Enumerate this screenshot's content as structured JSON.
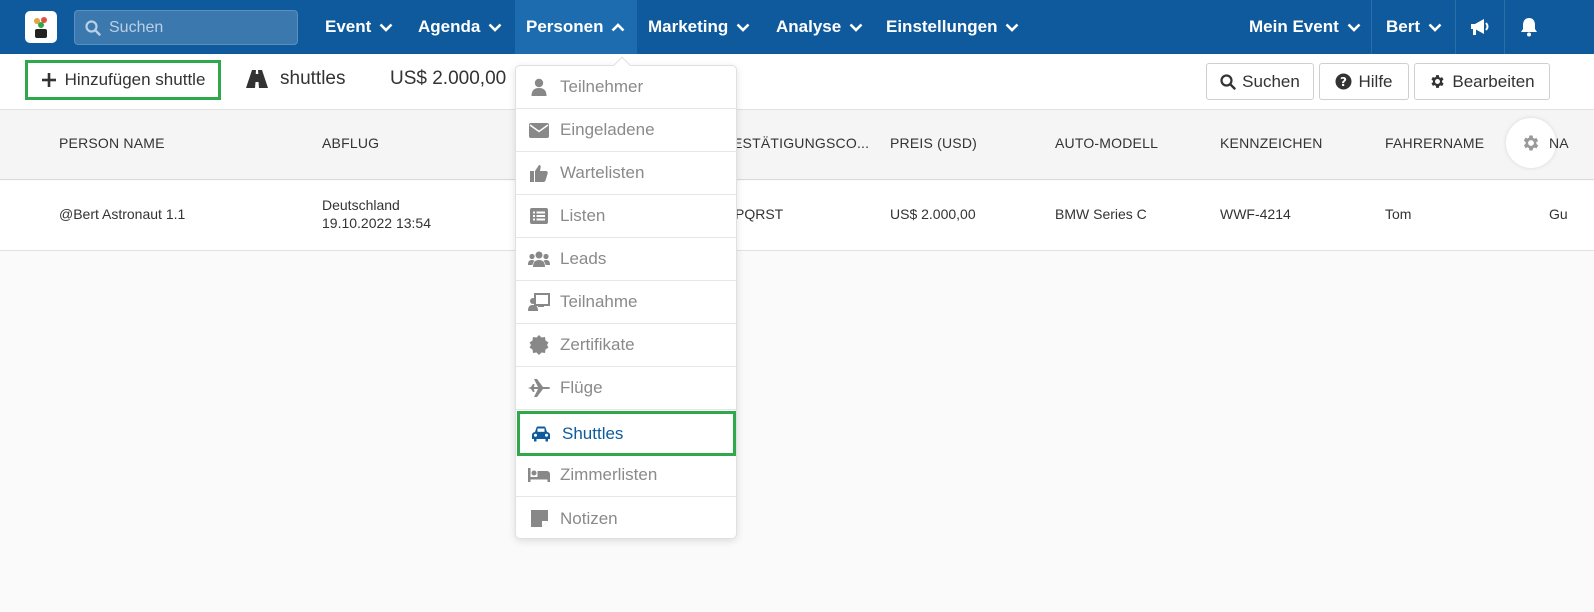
{
  "topnav": {
    "search_placeholder": "Suchen",
    "items": [
      {
        "label": "Event"
      },
      {
        "label": "Agenda"
      },
      {
        "label": "Personen"
      },
      {
        "label": "Marketing"
      },
      {
        "label": "Analyse"
      },
      {
        "label": "Einstellungen"
      }
    ],
    "right": {
      "event_label": "Mein Event",
      "user_label": "Bert"
    },
    "colors": {
      "nav_bg": "#0e5a9c",
      "active_bg": "#1d6cb0"
    }
  },
  "toolbar": {
    "add_label": "Hinzufügen shuttle",
    "section_label": "shuttles",
    "total": "US$ 2.000,00",
    "search_label": "Suchen",
    "help_label": "Hilfe",
    "edit_label": "Bearbeiten"
  },
  "table": {
    "columns": [
      "PERSON NAME",
      "ABFLUG",
      "ESTÄTIGUNGSCO...",
      "PREIS (USD)",
      "AUTO-MODELL",
      "KENNZEICHEN",
      "FAHRERNAME",
      "NA"
    ],
    "rows": [
      {
        "person": "@Bert Astronaut 1.1",
        "abflug_place": "Deutschland",
        "abflug_date": "19.10.2022 13:54",
        "code": "PQRST",
        "price": "US$ 2.000,00",
        "car": "BMW Series C",
        "plate": "WWF-4214",
        "driver": "Tom",
        "na": "Gu"
      }
    ]
  },
  "dropdown": {
    "items": [
      {
        "label": "Teilnehmer",
        "icon": "user-icon"
      },
      {
        "label": "Eingeladene",
        "icon": "envelope-icon"
      },
      {
        "label": "Wartelisten",
        "icon": "thumbs-up-icon"
      },
      {
        "label": "Listen",
        "icon": "list-icon"
      },
      {
        "label": "Leads",
        "icon": "users-icon"
      },
      {
        "label": "Teilnahme",
        "icon": "presentation-icon"
      },
      {
        "label": "Zertifikate",
        "icon": "certificate-icon"
      },
      {
        "label": "Flüge",
        "icon": "plane-icon"
      },
      {
        "label": "Shuttles",
        "icon": "car-icon",
        "active": true
      },
      {
        "label": "Zimmerlisten",
        "icon": "bed-icon"
      },
      {
        "label": "Notizen",
        "icon": "note-icon"
      }
    ],
    "colors": {
      "highlight": "#2ea84a",
      "active_text": "#0e5a9c"
    }
  }
}
